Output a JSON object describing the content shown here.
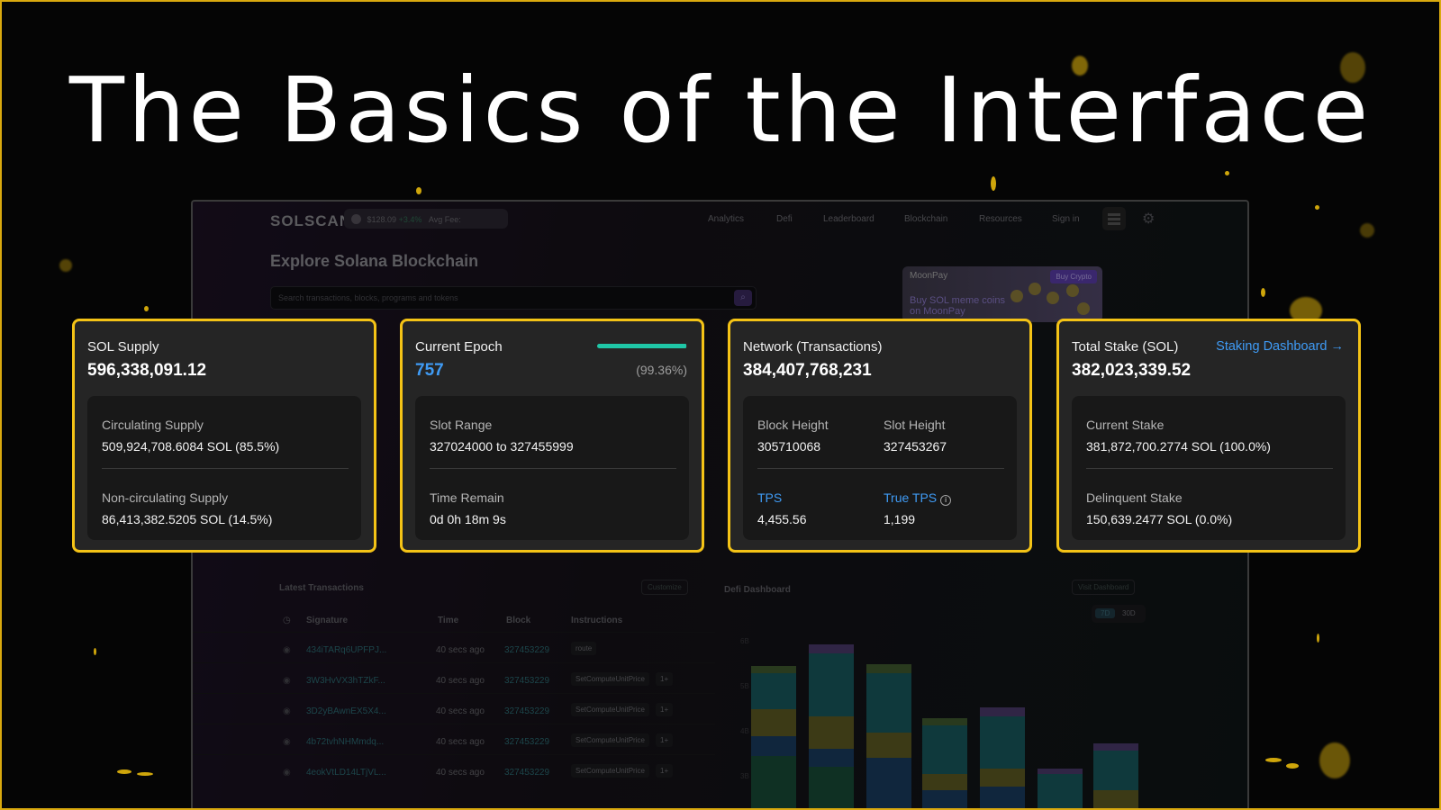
{
  "headline": "The Basics of the Interface",
  "background": {
    "logo": "SOLSCAN",
    "price": "$128.09",
    "price_change": "+3.4%",
    "avg_fee_label": "Avg Fee:",
    "nav": [
      "Analytics",
      "Defi",
      "Leaderboard",
      "Blockchain",
      "Resources",
      "Sign in"
    ],
    "explore_title": "Explore Solana Blockchain",
    "search_placeholder": "Search transactions, blocks, programs and tokens",
    "ad_brand": "MoonPay",
    "ad_cta": "Buy Crypto",
    "ad_copy": "Buy SOL meme coins on MoonPay",
    "latest_tx_title": "Latest Transactions",
    "customize_label": "Customize",
    "defi_title": "Defi Dashboard",
    "visit_dashboard_label": "Visit Dashboard",
    "tx_columns": [
      "Signature",
      "Time",
      "Block",
      "Instructions"
    ],
    "tx_rows": [
      {
        "sig": "434iTARq6UPFPJ...",
        "time": "40 secs ago",
        "block": "327453229",
        "ins": "route",
        "more": ""
      },
      {
        "sig": "3W3HvVX3hTZkF...",
        "time": "40 secs ago",
        "block": "327453229",
        "ins": "SetComputeUnitPrice",
        "more": "1+"
      },
      {
        "sig": "3D2yBAwnEX5X4...",
        "time": "40 secs ago",
        "block": "327453229",
        "ins": "SetComputeUnitPrice",
        "more": "1+"
      },
      {
        "sig": "4b72tvhNHMmdq...",
        "time": "40 secs ago",
        "block": "327453229",
        "ins": "SetComputeUnitPrice",
        "more": "1+"
      },
      {
        "sig": "4eokVtLD14LTjVL...",
        "time": "40 secs ago",
        "block": "327453229",
        "ins": "SetComputeUnitPrice",
        "more": "1+"
      }
    ],
    "toggle": [
      "7D",
      "30D"
    ],
    "axis_ticks": [
      "6B",
      "5B",
      "4B",
      "3B"
    ]
  },
  "cards": {
    "supply": {
      "title": "SOL Supply",
      "value": "596,338,091.12",
      "circ_label": "Circulating Supply",
      "circ_value": "509,924,708.6084 SOL (85.5%)",
      "noncirc_label": "Non-circulating Supply",
      "noncirc_value": "86,413,382.5205 SOL (14.5%)"
    },
    "epoch": {
      "title": "Current Epoch",
      "value": "757",
      "progress_pct": "(99.36%)",
      "progress_value": 0.9936,
      "slot_label": "Slot Range",
      "slot_value": "327024000 to 327455999",
      "time_label": "Time Remain",
      "time_value": "0d 0h 18m 9s"
    },
    "network": {
      "title": "Network (Transactions)",
      "value": "384,407,768,231",
      "block_label": "Block Height",
      "block_value": "305710068",
      "slot_label": "Slot Height",
      "slot_value": "327453267",
      "tps_label": "TPS",
      "tps_value": "4,455.56",
      "true_tps_label": "True TPS",
      "true_tps_value": "1,199"
    },
    "stake": {
      "title": "Total Stake (SOL)",
      "link": "Staking Dashboard",
      "value": "382,023,339.52",
      "current_label": "Current Stake",
      "current_value": "381,872,700.2774 SOL (100.0%)",
      "delinquent_label": "Delinquent Stake",
      "delinquent_value": "150,639.2477 SOL (0.0%)"
    }
  },
  "colors": {
    "highlight": "#f4c316",
    "link": "#3f9bf5",
    "progress": "#1fc7a7"
  }
}
